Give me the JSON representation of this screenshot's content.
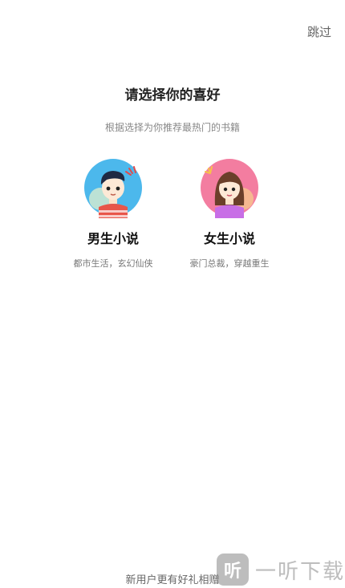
{
  "header": {
    "skip_label": "跳过"
  },
  "prompt": {
    "title": "请选择你的喜好",
    "subtitle": "根据选择为你推荐最热门的书籍"
  },
  "options": [
    {
      "label": "男生小说",
      "desc": "都市生活，玄幻仙侠",
      "icon": "male-avatar-icon"
    },
    {
      "label": "女生小说",
      "desc": "豪门总裁，穿越重生",
      "icon": "female-avatar-icon"
    }
  ],
  "footer": {
    "text": "新用户更有好礼相赠"
  },
  "watermark": {
    "logo_text": "听",
    "text": "一听下载"
  },
  "colors": {
    "male_bg": "#4cb8ec",
    "female_bg": "#f37da0",
    "male_shirt": "#e8564a",
    "female_shirt": "#c86ee6"
  }
}
